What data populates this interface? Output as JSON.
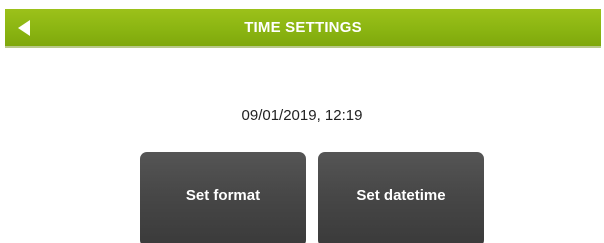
{
  "header": {
    "title": "TIME SETTINGS",
    "back_icon": "left-triangle-arrow",
    "color": "#8bb512"
  },
  "main": {
    "current_datetime": "09/01/2019, 12:19",
    "buttons": {
      "set_format_label": "Set format",
      "set_datetime_label": "Set datetime"
    },
    "button_color": "#474747"
  }
}
